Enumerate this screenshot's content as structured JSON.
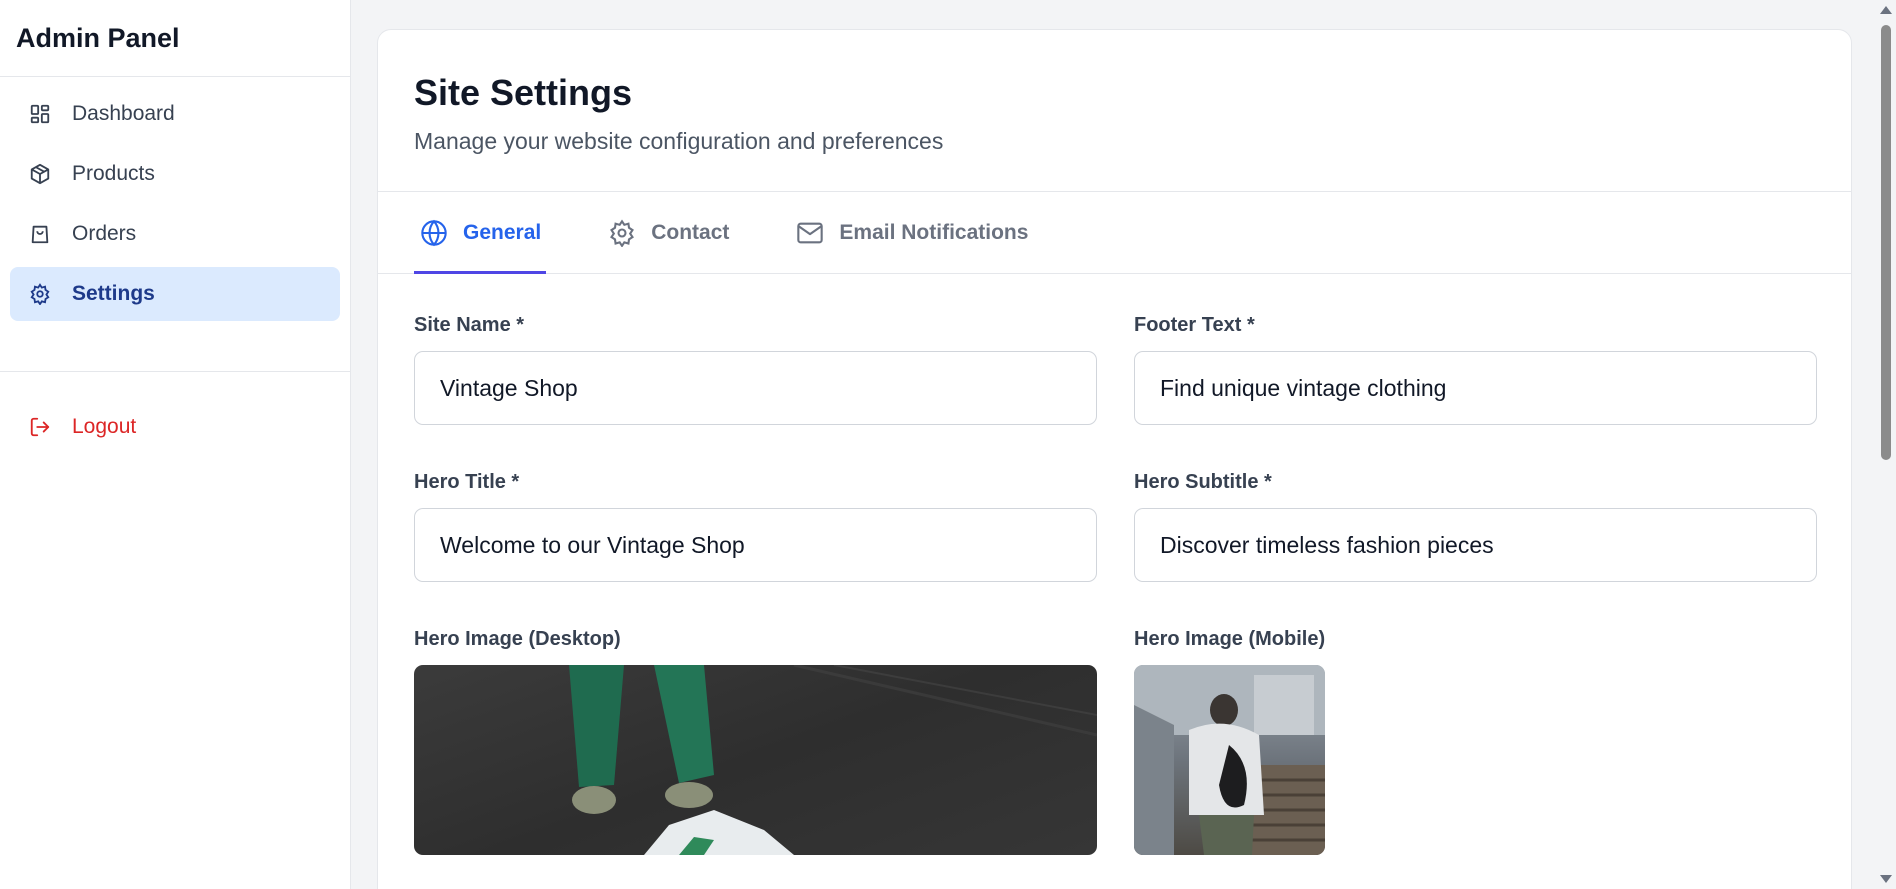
{
  "sidebar": {
    "brand": "Admin Panel",
    "items": [
      {
        "label": "Dashboard",
        "icon": "dashboard-icon"
      },
      {
        "label": "Products",
        "icon": "package-icon"
      },
      {
        "label": "Orders",
        "icon": "shopping-bag-icon"
      },
      {
        "label": "Settings",
        "icon": "gear-icon",
        "active": true
      }
    ],
    "logout": {
      "label": "Logout",
      "icon": "logout-icon"
    }
  },
  "header": {
    "title": "Site Settings",
    "subtitle": "Manage your website configuration and preferences"
  },
  "tabs": [
    {
      "label": "General",
      "icon": "globe-icon",
      "active": true
    },
    {
      "label": "Contact",
      "icon": "gear-icon"
    },
    {
      "label": "Email Notifications",
      "icon": "mail-icon"
    }
  ],
  "form": {
    "site_name": {
      "label": "Site Name *",
      "value": "Vintage Shop"
    },
    "footer_text": {
      "label": "Footer Text *",
      "value": "Find unique vintage clothing"
    },
    "hero_title": {
      "label": "Hero Title *",
      "value": "Welcome to our Vintage Shop"
    },
    "hero_subtitle": {
      "label": "Hero Subtitle *",
      "value": "Discover timeless fashion pieces"
    },
    "hero_image_desktop": {
      "label": "Hero Image (Desktop)"
    },
    "hero_image_mobile": {
      "label": "Hero Image (Mobile)"
    }
  },
  "colors": {
    "accent": "#2563eb",
    "tab_underline": "#4f46e5",
    "active_nav_bg": "#dbeafe",
    "danger": "#dc2626"
  }
}
